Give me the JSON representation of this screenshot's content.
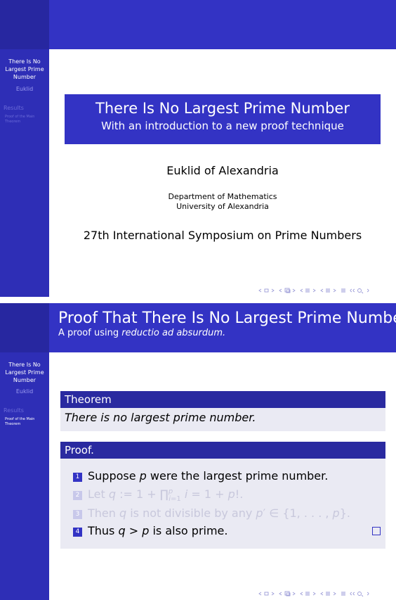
{
  "sidebar": {
    "title_lines": [
      "There Is No",
      "Largest Prime",
      "Number"
    ],
    "author": "Euklid",
    "section": "Results",
    "subsection_lines": [
      "Proof of the Main",
      "Theorem"
    ]
  },
  "slide1": {
    "title": "There Is No Largest Prime Number",
    "subtitle": "With an introduction to a new proof technique",
    "author": "Euklid of Alexandria",
    "institute_lines": [
      "Department of Mathematics",
      "University of Alexandria"
    ],
    "date": "27th International Symposium on Prime Numbers"
  },
  "slide2": {
    "frame_title": "Proof That There Is No Largest Prime Number",
    "frame_subtitle_prefix": "A proof using ",
    "frame_subtitle_em": "reductio ad absurdum.",
    "theorem_label": "Theorem",
    "theorem_text": "There is no largest prime number.",
    "proof_label": "Proof.",
    "steps": [
      {
        "n": "1",
        "text_html": "Suppose <i>p</i> were the largest prime number."
      },
      {
        "n": "2",
        "text_html": "Let <i>q</i> := 1 + ∏<sup style=\"font-size:10px\"><i>p</i></sup><sub style=\"font-size:10px;margin-left:-6px\"><i>i</i>=1</sub> <i>i</i> = 1 + <i>p</i>!."
      },
      {
        "n": "3",
        "text_html": "Then <i>q</i> is not divisible by any <i>p</i>′ ∈ {1, . . . , <i>p</i>}."
      },
      {
        "n": "4",
        "text_html": "Thus <i>q</i> &gt; <i>p</i> is also prime."
      }
    ]
  },
  "colors": {
    "sidebar": "#2e2eb6",
    "header": "#3333c4",
    "block_head": "#2a2aa0",
    "block_body": "#eaeaf3"
  }
}
